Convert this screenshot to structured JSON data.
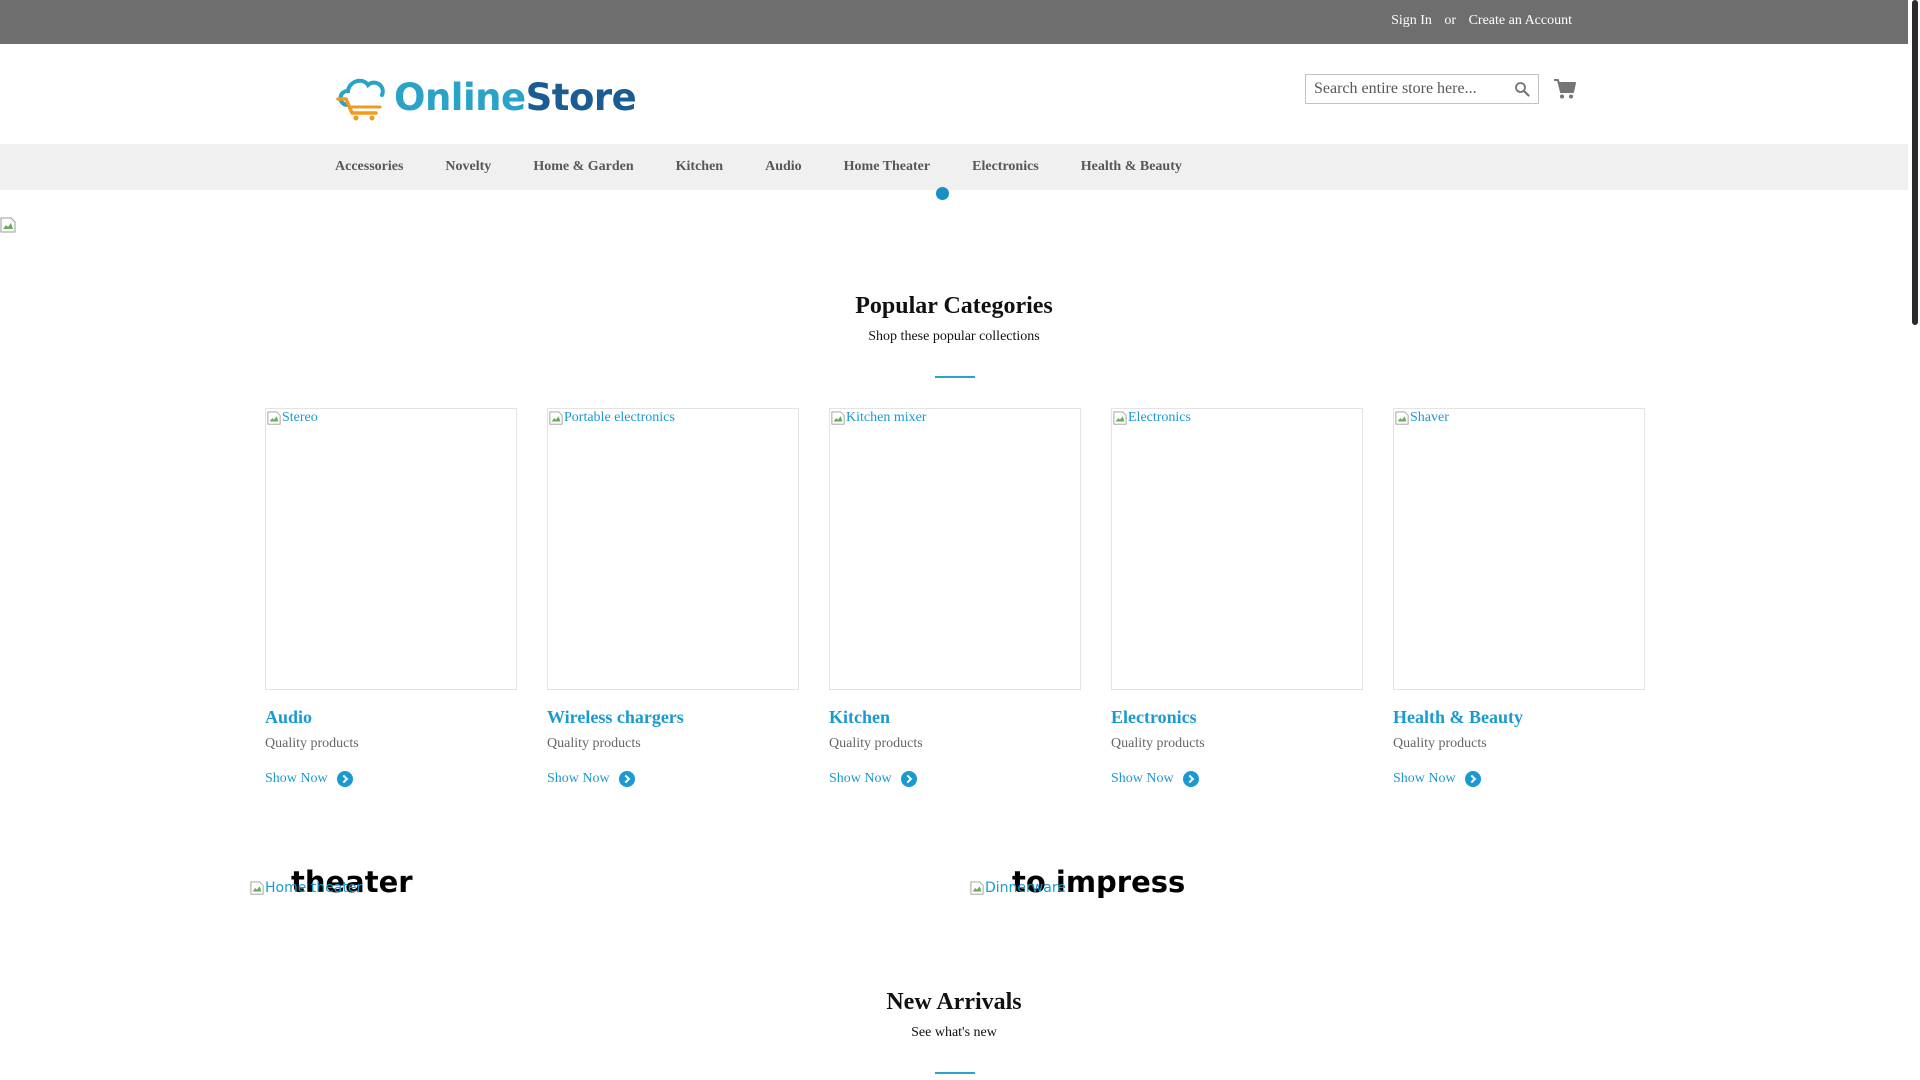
{
  "topbar": {
    "sign_in": "Sign In",
    "or": "or",
    "create_account": "Create an Account"
  },
  "logo": {
    "online": "Online",
    "store": "Store",
    "colors": {
      "online": "#2aa3c8",
      "store": "#1b5c93",
      "cart_accent": "#f39a1e"
    }
  },
  "search": {
    "placeholder": "Search entire store here...",
    "icon": "search-icon"
  },
  "cart": {
    "icon": "cart-icon"
  },
  "nav": {
    "items": [
      {
        "label": "Accessories"
      },
      {
        "label": "Novelty"
      },
      {
        "label": "Home & Garden"
      },
      {
        "label": "Kitchen"
      },
      {
        "label": "Audio"
      },
      {
        "label": "Home Theater"
      },
      {
        "label": "Electronics"
      },
      {
        "label": "Health & Beauty"
      }
    ]
  },
  "popular": {
    "title": "Popular Categories",
    "subtitle": "Shop these popular collections",
    "cards": [
      {
        "alt": "Stereo",
        "title": "Audio",
        "quality": "Quality products",
        "show": "Show Now"
      },
      {
        "alt": "Portable electronics",
        "title": "Wireless chargers",
        "quality": "Quality products",
        "show": "Show Now"
      },
      {
        "alt": "Kitchen mixer",
        "title": "Kitchen",
        "quality": "Quality products",
        "show": "Show Now"
      },
      {
        "alt": "Electronics",
        "title": "Electronics",
        "quality": "Quality products",
        "show": "Show Now"
      },
      {
        "alt": "Shaver",
        "title": "Health & Beauty",
        "quality": "Quality products",
        "show": "Show Now"
      }
    ]
  },
  "promos": [
    {
      "heading": "theater",
      "alt": "Home theater"
    },
    {
      "heading": "to impress",
      "alt": "Dinnerware"
    }
  ],
  "arrivals": {
    "title": "New Arrivals",
    "subtitle": "See what's new"
  },
  "colors": {
    "accent": "#1a9ad0",
    "topbar": "#6e6e6e",
    "nav_bg": "#f0f0f0"
  }
}
